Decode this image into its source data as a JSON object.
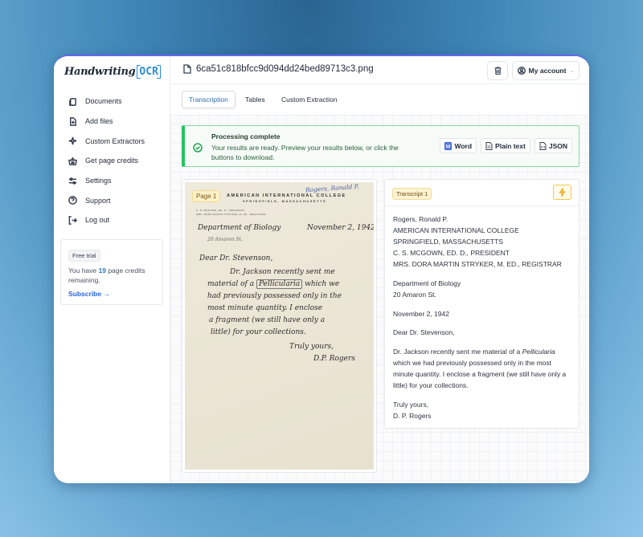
{
  "app": {
    "logo_script": "Handwriting",
    "logo_mark": "OCR"
  },
  "sidebar": {
    "items": [
      {
        "label": "Documents",
        "icon": "documents-icon"
      },
      {
        "label": "Add files",
        "icon": "file-plus-icon"
      },
      {
        "label": "Custom Extractors",
        "icon": "sparkle-icon"
      },
      {
        "label": "Get page credits",
        "icon": "basket-icon"
      },
      {
        "label": "Settings",
        "icon": "sliders-icon"
      },
      {
        "label": "Support",
        "icon": "help-circle-icon"
      },
      {
        "label": "Log out",
        "icon": "log-out-icon"
      }
    ],
    "trial": {
      "badge": "Free trial",
      "text_before": "You have ",
      "credits": "19",
      "text_after": " page credits remaining.",
      "link": "Subscribe →"
    }
  },
  "header": {
    "file_name": "6ca51c818bfcc9d094dd24bed89713c3.png",
    "account_label": "My account",
    "chevron": "⌄"
  },
  "tabs": [
    {
      "label": "Transcription",
      "active": true
    },
    {
      "label": "Tables",
      "active": false
    },
    {
      "label": "Custom Extraction",
      "active": false
    }
  ],
  "banner": {
    "title": "Processing complete",
    "text": "Your results are ready. Preview your results below, or click the buttons to download.",
    "buttons": [
      {
        "label": "Word",
        "icon": "word-icon"
      },
      {
        "label": "Plain text",
        "icon": "text-file-icon"
      },
      {
        "label": "JSON",
        "icon": "json-file-icon"
      }
    ],
    "accent": "#22c55e"
  },
  "image_panel": {
    "page_badge": "Page 1",
    "letterhead_line1": "AMERICAN INTERNATIONAL COLLEGE",
    "letterhead_line2": "SPRINGFIELD, MASSACHUSETTS",
    "letterhead_small1": "C. S. MCGOWN, ED. D., PRESIDENT",
    "letterhead_small2": "MRS. DORA MARTIN STRYKER, M. ED., REGISTRAR",
    "note": "Rogers, Ronald P.",
    "hw_dept": "Department of Biology",
    "hw_date": "November 2, 1942",
    "hw_addr": "20 Amaron St.",
    "hw_greeting": "Dear Dr. Stevenson,",
    "hw_l1": "Dr. Jackson recently sent me",
    "hw_l2a": "material of a",
    "hw_l2b": "Pellicularia",
    "hw_l2c": "which we",
    "hw_l3": "had previously possessed only in the",
    "hw_l4": "most minute quantity. I enclose",
    "hw_l5": "a fragment (we still have only a",
    "hw_l6": "little) for your collections.",
    "hw_close": "Truly yours,",
    "hw_sig": "D.P. Rogers"
  },
  "transcript": {
    "badge": "Transcript 1",
    "header_lines": [
      "Rogers, Ronald P.",
      "AMERICAN INTERNATIONAL COLLEGE",
      "SPRINGFIELD, MASSACHUSETTS",
      "C. S. MCGOWN, ED. D., PRESIDENT",
      "MRS. DORA MARTIN STRYKER, M. ED., REGISTRAR"
    ],
    "dept_lines": [
      "Department of Biology",
      "20 Amaron St."
    ],
    "date": "November 2, 1942",
    "greeting": "Dear Dr. Stevenson,",
    "body_before": "Dr. Jackson recently sent me material of a ",
    "body_italic": "Pellicularia",
    "body_after": " which we had previously possessed only in the most minute quantity. I enclose a fragment (we still have only a little) for your collections.",
    "closing": [
      "Truly yours,",
      "D. P. Rogers"
    ]
  }
}
